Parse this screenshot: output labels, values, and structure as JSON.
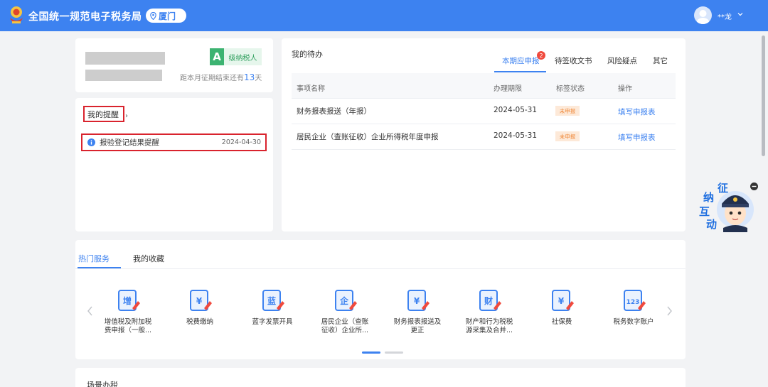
{
  "header": {
    "site_title": "全国统一规范电子税务局",
    "city": "厦门",
    "user_name": "**龙"
  },
  "taxpayer": {
    "grade": "A",
    "grade_label": "级纳税人",
    "deadline_prefix": "距本月征期结束还有",
    "deadline_days": "13",
    "deadline_suffix": "天"
  },
  "reminders": {
    "title": "我的提醒",
    "tail": "›",
    "items": [
      {
        "text": "报验登记结果提醒",
        "date": "2024-04-30"
      }
    ]
  },
  "todo": {
    "title": "我的待办",
    "tabs": [
      {
        "label": "本期应申报",
        "count": "2",
        "active": true
      },
      {
        "label": "待签收文书",
        "active": false
      },
      {
        "label": "风险疑点",
        "active": false
      },
      {
        "label": "其它",
        "active": false
      }
    ],
    "columns": [
      "事项名称",
      "办理期限",
      "标签状态",
      "操作"
    ],
    "rows": [
      {
        "name": "财务报表报送（年报）",
        "deadline": "2024-05-31",
        "status": "未申报",
        "action": "填写申报表"
      },
      {
        "name": "居民企业（查账征收）企业所得税年度申报",
        "deadline": "2024-05-31",
        "status": "未申报",
        "action": "填写申报表"
      }
    ]
  },
  "services": {
    "tabs": [
      {
        "label": "热门服务",
        "active": true
      },
      {
        "label": "我的收藏",
        "active": false
      }
    ],
    "items": [
      {
        "label": "增值税及附加税\n费申报（一般...",
        "icon": "vat-declaration-icon",
        "glyph": "增"
      },
      {
        "label": "税费缴纳",
        "icon": "tax-payment-icon",
        "glyph": "¥"
      },
      {
        "label": "蓝字发票开具",
        "icon": "invoice-print-icon",
        "glyph": "蓝"
      },
      {
        "label": "居民企业（查账\n征收）企业所...",
        "icon": "enterprise-income-tax-icon",
        "glyph": "企"
      },
      {
        "label": "财务报表报送及\n更正",
        "icon": "financial-report-icon",
        "glyph": "¥"
      },
      {
        "label": "财产和行为税税\n源采集及合并...",
        "icon": "property-tax-icon",
        "glyph": "财"
      },
      {
        "label": "社保费",
        "icon": "social-insurance-icon",
        "glyph": "¥"
      },
      {
        "label": "税务数字账户",
        "icon": "digital-account-icon",
        "glyph": "123"
      }
    ]
  },
  "scene": {
    "title": "场景办税"
  },
  "mascot": {
    "chars": [
      "征",
      "纳",
      "互",
      "动"
    ]
  },
  "colors": {
    "brand": "#3d82f0",
    "alert_red": "#d9232d",
    "grade_green": "#3cb371",
    "status_orange": "#f08a3c"
  }
}
